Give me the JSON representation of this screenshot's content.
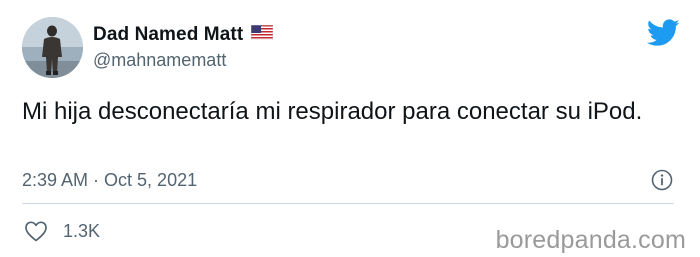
{
  "author": {
    "display_name": "Dad Named Matt",
    "handle": "@mahnamematt",
    "flag_icon": "us-flag-icon",
    "avatar_icon": "avatar"
  },
  "tweet": {
    "text": "Mi hija desconectaría mi respirador para conectar su iPod.",
    "timestamp": "2:39 AM · Oct 5, 2021"
  },
  "actions": {
    "like_count": "1.3K",
    "like_icon": "heart-icon",
    "info_icon": "info-icon"
  },
  "branding": {
    "twitter_icon": "twitter-bird-icon",
    "watermark": "boredpanda.com"
  },
  "colors": {
    "twitter_blue": "#1d9bf0",
    "text": "#0f1419",
    "secondary_text": "#536471",
    "divider": "#cfd9de",
    "watermark": "#9a9a9a"
  }
}
